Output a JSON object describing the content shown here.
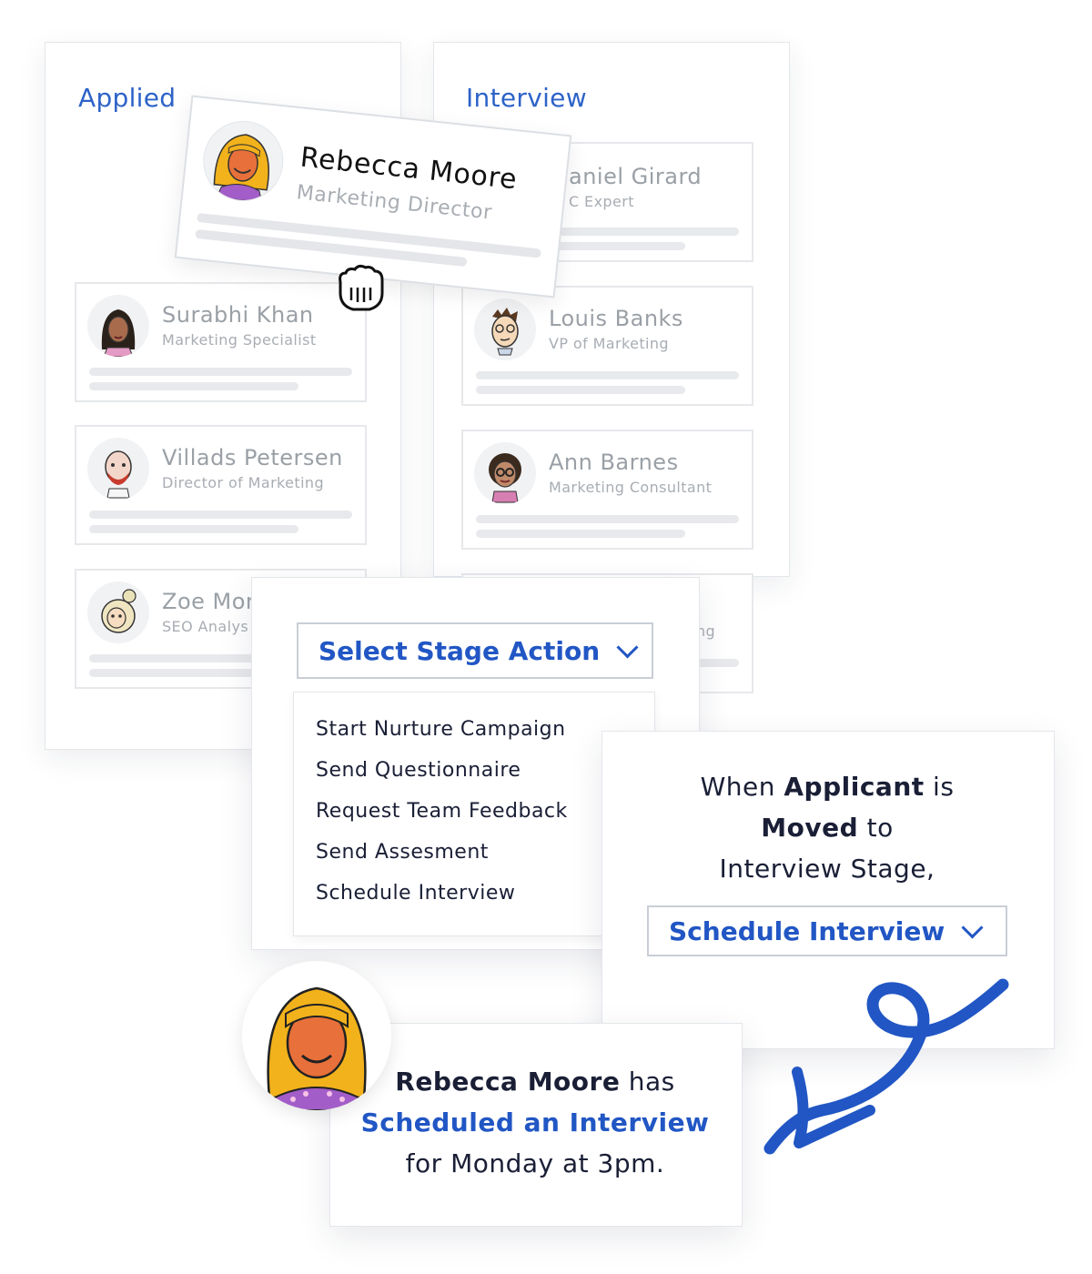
{
  "columns": {
    "applied": {
      "title": "Applied"
    },
    "interview": {
      "title": "Interview"
    }
  },
  "dragged_card": {
    "name": "Rebecca Moore",
    "role": "Marketing Director",
    "avatar_icon": "woman-yellow-hair-avatar"
  },
  "applied_cards": [
    {
      "name": "Surabhi Khan",
      "role": "Marketing Specialist",
      "avatar_icon": "woman-dark-hair-avatar"
    },
    {
      "name": "Villads Petersen",
      "role": "Director of Marketing",
      "avatar_icon": "bald-man-beard-avatar"
    },
    {
      "name": "Zoe Mor",
      "role": "SEO Analys",
      "avatar_icon": "woman-bun-avatar"
    }
  ],
  "interview_cards": [
    {
      "name": "aniel Girard",
      "role": "C Expert"
    },
    {
      "name": "Louis Banks",
      "role": "VP of Marketing",
      "avatar_icon": "man-glasses-avatar"
    },
    {
      "name": "Ann Barnes",
      "role": "Marketing Consultant",
      "avatar_icon": "woman-glasses-avatar"
    },
    {
      "name": "",
      "role": "ng"
    }
  ],
  "cursor_icon": "grab-hand-icon",
  "stage_action": {
    "select_label": "Select Stage Action",
    "options": [
      "Start Nurture Campaign",
      "Send Questionnaire",
      "Request Team Feedback",
      "Send Assesment",
      "Schedule Interview"
    ]
  },
  "rule": {
    "line1_pre": "When ",
    "line1_bold": "Applicant",
    "line1_post": " is",
    "line2_bold": "Moved",
    "line2_post": " to",
    "line3": "Interview Stage,",
    "select_value": "Schedule Interview"
  },
  "notification": {
    "name": "Rebecca Moore",
    "has": " has",
    "action": "Scheduled an Interview",
    "when": "for Monday at 3pm."
  },
  "colors": {
    "accent": "#2156c4",
    "title_blue": "#2d63c8",
    "muted_text": "#9aa0a6",
    "border": "#e3e6ea"
  }
}
